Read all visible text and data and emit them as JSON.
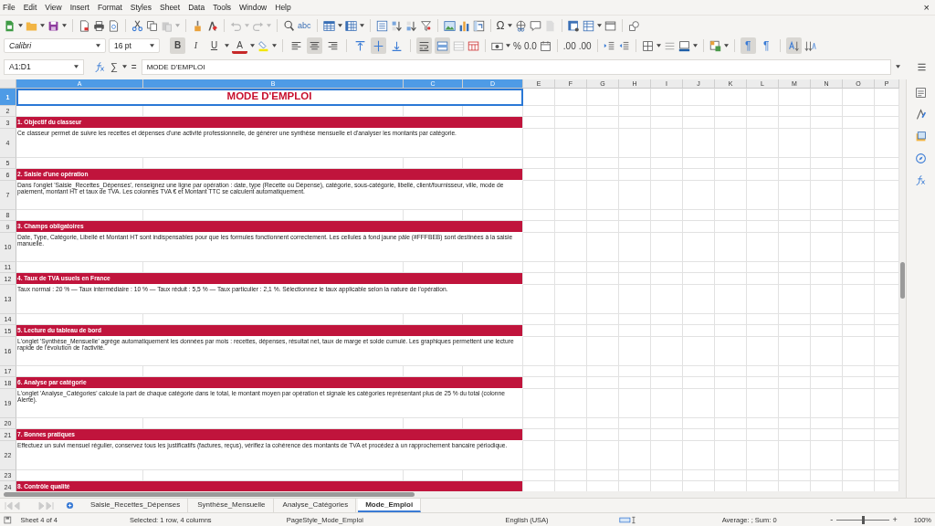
{
  "menu": [
    "File",
    "Edit",
    "View",
    "Insert",
    "Format",
    "Styles",
    "Sheet",
    "Data",
    "Tools",
    "Window",
    "Help"
  ],
  "close_label": "×",
  "standard_toolbar": {
    "spelling_label": "abc",
    "special_char_label": "Ω"
  },
  "format_toolbar": {
    "font_name": "Calibri",
    "font_size": "16 pt",
    "bold_label": "B",
    "italic_label": "I",
    "underline_label": "U",
    "font_color_label": "A",
    "bold": true,
    "italic": false,
    "underline": false,
    "align_left": false,
    "align_center": true,
    "align_right": false,
    "valign_top": false,
    "valign_center": true,
    "valign_bottom": false,
    "wrap_text": true,
    "merge_center": true,
    "percent_label": "%",
    "decimal_label": "0.0",
    "add_decimal_label": ".00",
    "remove_decimal_label": ".00",
    "ltr_label": "¶",
    "rtl_label": "¶",
    "left_to_right": true,
    "right_to_left": false,
    "vertical_text": true
  },
  "formula_bar": {
    "name_box": "A1:D1",
    "sum_label": "∑",
    "equals_label": "=",
    "content": "MODE D'EMPLOI"
  },
  "columns": [
    {
      "label": "A",
      "selected": true
    },
    {
      "label": "B",
      "selected": true
    },
    {
      "label": "C",
      "selected": true
    },
    {
      "label": "D",
      "selected": true
    },
    {
      "label": "E",
      "selected": false
    },
    {
      "label": "F",
      "selected": false
    },
    {
      "label": "G",
      "selected": false
    },
    {
      "label": "H",
      "selected": false
    },
    {
      "label": "I",
      "selected": false
    },
    {
      "label": "J",
      "selected": false
    },
    {
      "label": "K",
      "selected": false
    },
    {
      "label": "L",
      "selected": false
    },
    {
      "label": "M",
      "selected": false
    },
    {
      "label": "N",
      "selected": false
    },
    {
      "label": "O",
      "selected": false
    },
    {
      "label": "P",
      "selected": false
    }
  ],
  "rows": [
    {
      "number": "1",
      "selected": true,
      "kind": "title",
      "text": "MODE D'EMPLOI"
    },
    {
      "number": "2",
      "selected": false,
      "kind": "blank"
    },
    {
      "number": "3",
      "selected": false,
      "kind": "header",
      "text": "1. Objectif du classeur"
    },
    {
      "number": "4",
      "selected": false,
      "kind": "text",
      "text": "Ce classeur permet de suivre les recettes et dépenses d'une activité professionnelle, de générer une synthèse mensuelle et d'analyser les montants par catégorie."
    },
    {
      "number": "5",
      "selected": false,
      "kind": "blank"
    },
    {
      "number": "6",
      "selected": false,
      "kind": "header",
      "text": "2. Saisie d'une opération"
    },
    {
      "number": "7",
      "selected": false,
      "kind": "text",
      "text": "Dans l'onglet 'Saisie_Recettes_Dépenses', renseignez une ligne par opération : date, type (Recette ou Dépense), catégorie, sous-catégorie, libellé, client/fournisseur, ville, mode de paiement, montant HT et taux de TVA. Les colonnes TVA € et Montant TTC se calculent automatiquement."
    },
    {
      "number": "8",
      "selected": false,
      "kind": "blank"
    },
    {
      "number": "9",
      "selected": false,
      "kind": "header",
      "text": "3. Champs obligatoires"
    },
    {
      "number": "10",
      "selected": false,
      "kind": "text",
      "text": "Date, Type, Catégorie, Libellé et Montant HT sont indispensables pour que les formules fonctionnent correctement. Les cellules à fond jaune pâle (#FFFBEB) sont destinées à la saisie manuelle."
    },
    {
      "number": "11",
      "selected": false,
      "kind": "blank"
    },
    {
      "number": "12",
      "selected": false,
      "kind": "header",
      "text": "4. Taux de TVA usuels en France"
    },
    {
      "number": "13",
      "selected": false,
      "kind": "text",
      "text": "Taux normal : 20 % — Taux intermédiaire : 10 % — Taux réduit : 5,5 % — Taux particulier : 2,1 %. Sélectionnez le taux applicable selon la nature de l'opération."
    },
    {
      "number": "14",
      "selected": false,
      "kind": "blank"
    },
    {
      "number": "15",
      "selected": false,
      "kind": "header",
      "text": "5. Lecture du tableau de bord"
    },
    {
      "number": "16",
      "selected": false,
      "kind": "text",
      "text": "L'onglet 'Synthèse_Mensuelle' agrège automatiquement les données par mois : recettes, dépenses, résultat net, taux de marge et solde cumulé. Les graphiques permettent une lecture rapide de l'évolution de l'activité."
    },
    {
      "number": "17",
      "selected": false,
      "kind": "blank"
    },
    {
      "number": "18",
      "selected": false,
      "kind": "header",
      "text": "6. Analyse par catégorie"
    },
    {
      "number": "19",
      "selected": false,
      "kind": "text",
      "text": "L'onglet 'Analyse_Catégories' calcule la part de chaque catégorie dans le total, le montant moyen par opération et signale les catégories représentant plus de 25 % du total (colonne Alerte)."
    },
    {
      "number": "20",
      "selected": false,
      "kind": "blank"
    },
    {
      "number": "21",
      "selected": false,
      "kind": "header",
      "text": "7. Bonnes pratiques"
    },
    {
      "number": "22",
      "selected": false,
      "kind": "text",
      "text": "Effectuez un suivi mensuel régulier, conservez tous les justificatifs (factures, reçus), vérifiez la cohérence des montants de TVA et procédez à un rapprochement bancaire périodique."
    },
    {
      "number": "23",
      "selected": false,
      "kind": "blank"
    },
    {
      "number": "24",
      "selected": false,
      "kind": "header",
      "text": "8. Contrôle qualité"
    }
  ],
  "sheets": [
    {
      "label": "Saisie_Recettes_Dépenses",
      "selected": false
    },
    {
      "label": "Synthèse_Mensuelle",
      "selected": false
    },
    {
      "label": "Analyse_Catégories",
      "selected": false
    },
    {
      "label": "Mode_Emploi",
      "selected": true
    }
  ],
  "status_bar": {
    "sheet": "Sheet 4 of 4",
    "selection": "Selected: 1 row, 4 columns",
    "page_style": "PageStyle_Mode_Emploi",
    "language": "English (USA)",
    "summary": "Average: ; Sum: 0",
    "zoom_minus": "-",
    "zoom_plus": "+",
    "zoom": {
      "level": 0.5,
      "value": "100%"
    }
  }
}
